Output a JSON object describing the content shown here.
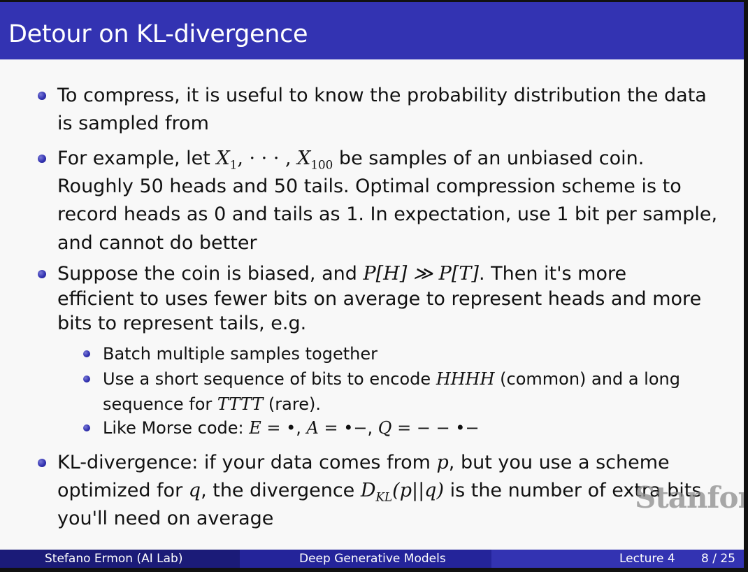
{
  "slide": {
    "title": "Detour on KL-divergence"
  },
  "bullets": {
    "b1_l1": "To compress, it is useful to know the probability distribution the data",
    "b1_l2": "is sampled from",
    "b2_l1_a": "For example, let ",
    "b2_l1_x1": "X",
    "b2_l1_x1_sub": "1",
    "b2_l1_dots": ", · · · , ",
    "b2_l1_x2": "X",
    "b2_l1_x2_sub": "100",
    "b2_l1_b": " be samples of an unbiased coin.",
    "b2_l2": "Roughly 50 heads and 50 tails. Optimal compression scheme is to",
    "b2_l3": "record heads as 0 and tails as 1. In expectation, use 1 bit per sample,",
    "b2_l4": "and cannot do better",
    "b3_l1_a": "Suppose the coin is biased, and ",
    "b3_l1_math": "P[H] ≫ P[T]",
    "b3_l1_b": ". Then it's more",
    "b3_l2": "efficient to uses fewer bits on average to represent heads and more",
    "b3_l3": "bits to represent tails, e.g.",
    "b4_l1_a": "KL-divergence: if your data comes from ",
    "b4_l1_p": "p",
    "b4_l1_b": ", but you use a scheme",
    "b4_l2_a": "optimized for ",
    "b4_l2_q": "q",
    "b4_l2_b": ", the divergence ",
    "b4_l2_d": "D",
    "b4_l2_dsub": "KL",
    "b4_l2_math": "(p||q)",
    "b4_l2_c": " is the number of extra bits",
    "b4_l3": "you'll need on average"
  },
  "subbullets": {
    "s1": "Batch multiple samples together",
    "s2_l1_a": "Use a short sequence of bits to encode ",
    "s2_l1_m": "HHHH",
    "s2_l1_b": " (common) and a long",
    "s2_l2_a": "sequence for ",
    "s2_l2_m": "TTTT",
    "s2_l2_b": " (rare).",
    "s3_a": "Like Morse code: ",
    "s3_e": "E = •",
    "s3_sep1": ", ",
    "s3_aa": "A = •−",
    "s3_sep2": ", ",
    "s3_q": "Q = − − •−"
  },
  "watermark": "Stanfor",
  "footer": {
    "author": "Stefano Ermon  (AI Lab)",
    "course": "Deep Generative Models",
    "lecture": "Lecture 4",
    "page": "8 / 25"
  },
  "colors": {
    "accent": "#3333b2",
    "footer_dark": "#1b1b78",
    "footer_mid": "#24249a"
  }
}
